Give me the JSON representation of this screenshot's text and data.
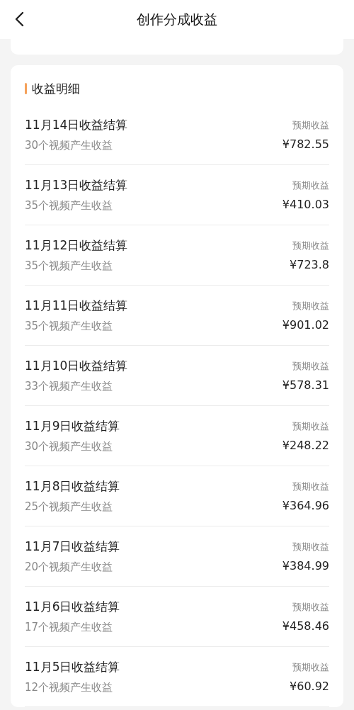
{
  "header": {
    "title": "创作分成收益"
  },
  "section": {
    "title": "收益明细"
  },
  "rows": [
    {
      "title": "11月14日收益结算",
      "subtitle": "30个视频产生收益",
      "label": "预期收益",
      "amount": "¥782.55"
    },
    {
      "title": "11月13日收益结算",
      "subtitle": "35个视频产生收益",
      "label": "预期收益",
      "amount": "¥410.03"
    },
    {
      "title": "11月12日收益结算",
      "subtitle": "35个视频产生收益",
      "label": "预期收益",
      "amount": "¥723.8"
    },
    {
      "title": "11月11日收益结算",
      "subtitle": "35个视频产生收益",
      "label": "预期收益",
      "amount": "¥901.02"
    },
    {
      "title": "11月10日收益结算",
      "subtitle": "33个视频产生收益",
      "label": "预期收益",
      "amount": "¥578.31"
    },
    {
      "title": "11月9日收益结算",
      "subtitle": "30个视频产生收益",
      "label": "预期收益",
      "amount": "¥248.22"
    },
    {
      "title": "11月8日收益结算",
      "subtitle": "25个视频产生收益",
      "label": "预期收益",
      "amount": "¥364.96"
    },
    {
      "title": "11月7日收益结算",
      "subtitle": "20个视频产生收益",
      "label": "预期收益",
      "amount": "¥384.99"
    },
    {
      "title": "11月6日收益结算",
      "subtitle": "17个视频产生收益",
      "label": "预期收益",
      "amount": "¥458.46"
    },
    {
      "title": "11月5日收益结算",
      "subtitle": "12个视频产生收益",
      "label": "预期收益",
      "amount": "¥60.92"
    }
  ]
}
